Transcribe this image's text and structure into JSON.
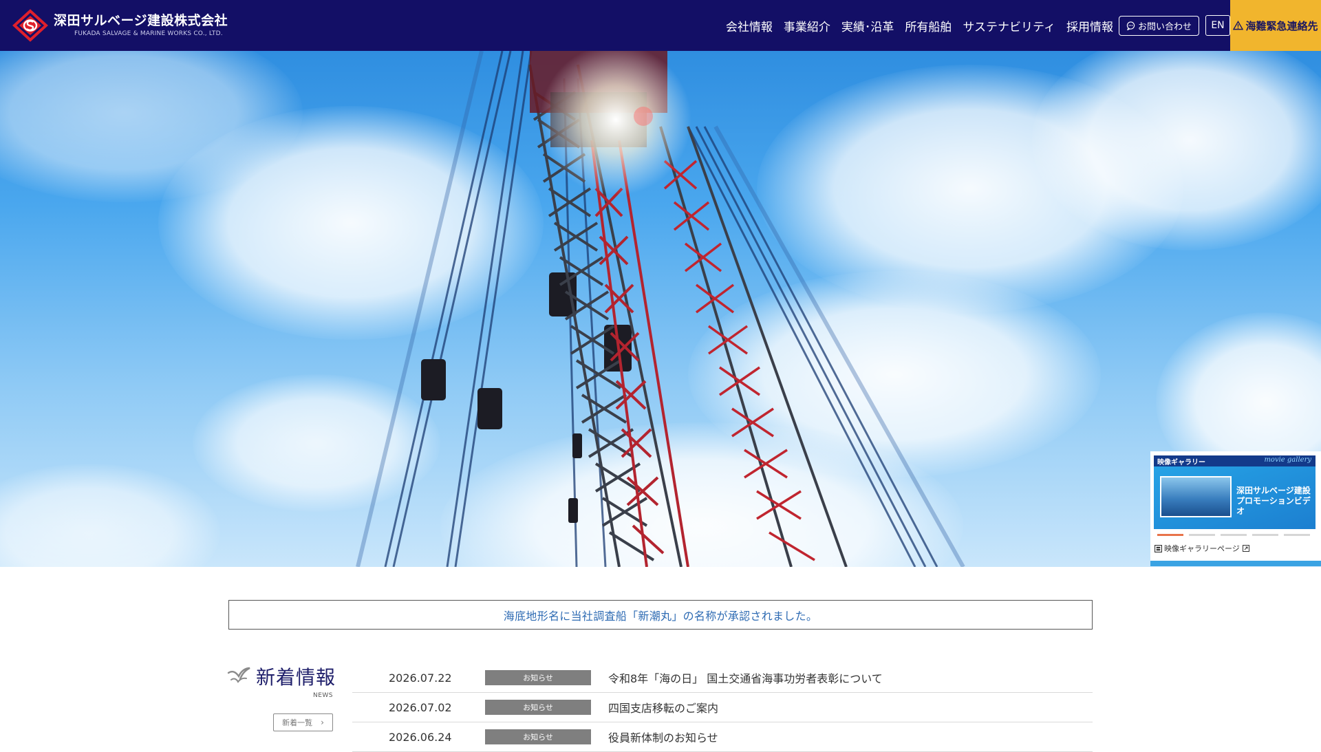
{
  "header": {
    "company_name": "深田サルベージ建設株式会社",
    "company_name_en": "FUKADA SALVAGE & MARINE WORKS CO., LTD.",
    "nav": [
      {
        "label": "会社情報"
      },
      {
        "label": "事業紹介"
      },
      {
        "label": "実績･沿革"
      },
      {
        "label": "所有船舶"
      },
      {
        "label": "サステナビリティ"
      },
      {
        "label": "採用情報"
      }
    ],
    "contact_label": "お問い合わせ",
    "lang_label": "EN",
    "emergency_label": "海難緊急連絡先",
    "brand_color": "#130f66",
    "emergency_color": "#f1b52d"
  },
  "gallery": {
    "header_jp": "映像ギャラリー",
    "header_en": "movie gallery",
    "banner_title": "深田サルベージ建設\nプロモーションビデオ",
    "link_label": "映像ギャラリーページ",
    "active_slide": 1,
    "slide_count": 5
  },
  "notice": {
    "text": "海底地形名に当社調査船「新潮丸」の名称が承認されました。"
  },
  "news": {
    "title": "新着情報",
    "subtitle": "NEWS",
    "all_label": "新着一覧",
    "items": [
      {
        "date": "2026.07.22",
        "category": "お知らせ",
        "title": "令和8年「海の日」 国土交通省海事功労者表彰について"
      },
      {
        "date": "2026.07.02",
        "category": "お知らせ",
        "title": "四国支店移転のご案内"
      },
      {
        "date": "2026.06.24",
        "category": "お知らせ",
        "title": "役員新体制のお知らせ"
      }
    ]
  }
}
